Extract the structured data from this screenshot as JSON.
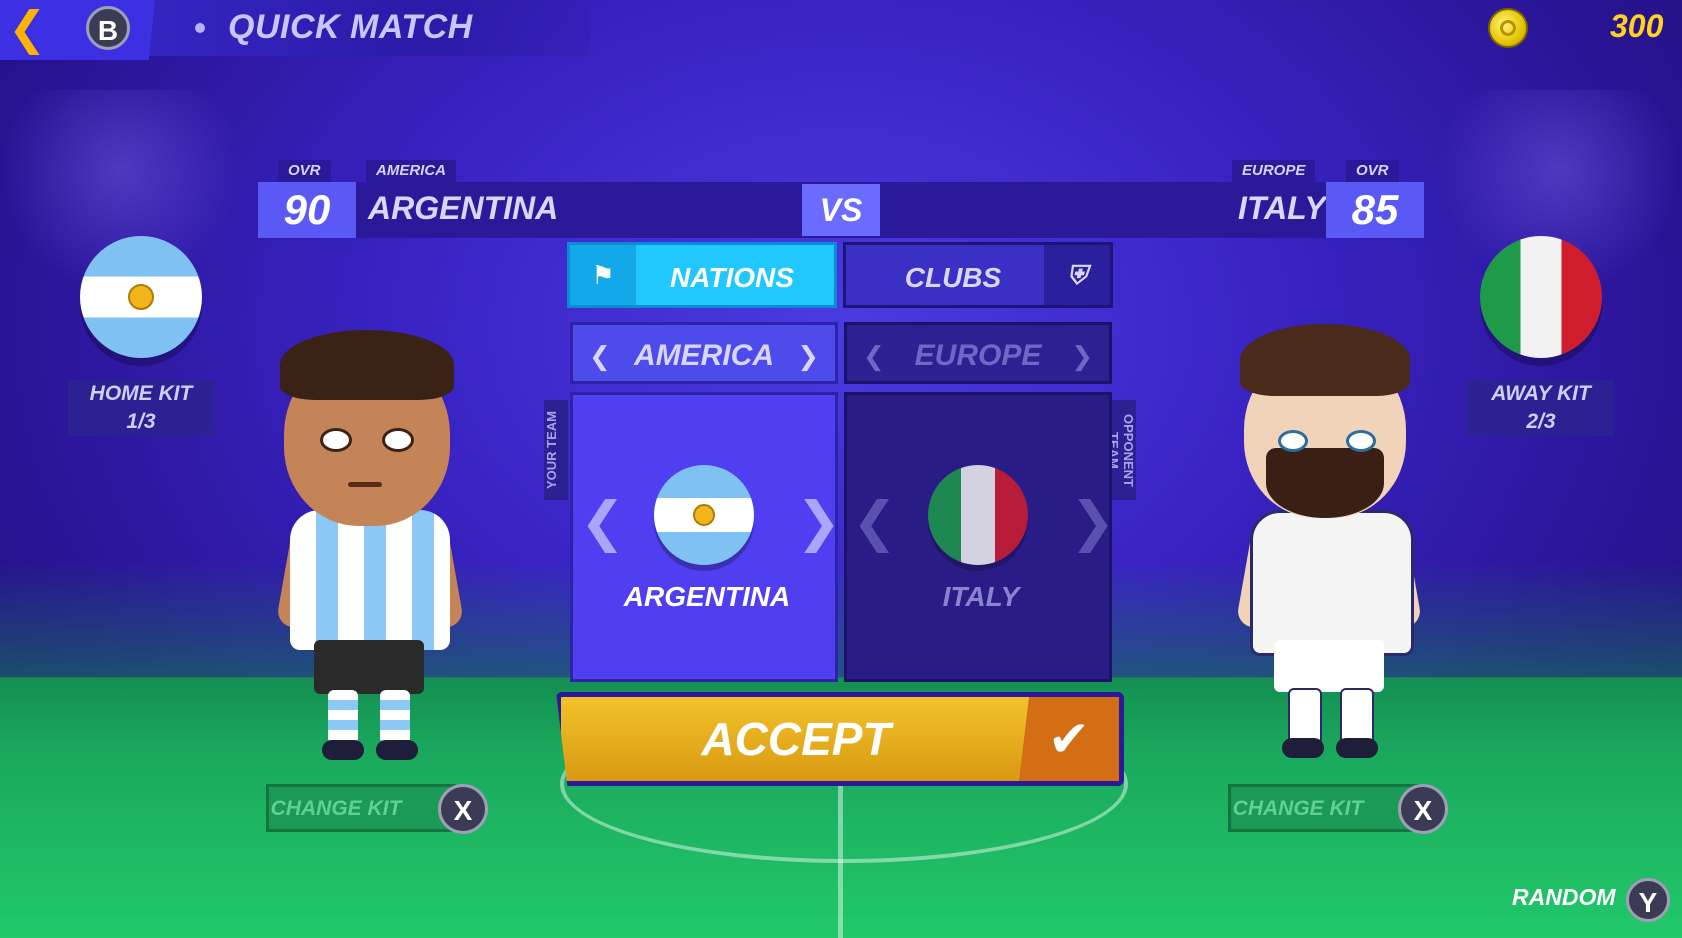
{
  "top_bar": {
    "back_button_key": "B",
    "title": "QUICK MATCH",
    "coins": "300",
    "icons": {
      "back": "chevron-left-icon",
      "coin": "coin-icon"
    }
  },
  "home_team": {
    "ovr_label": "OVR",
    "ovr": "90",
    "region_tag": "AMERICA",
    "name": "ARGENTINA",
    "kit_label": "HOME KIT",
    "kit_index": "1/3",
    "change_kit_label": "CHANGE KIT",
    "change_kit_key": "X"
  },
  "away_team": {
    "ovr_label": "OVR",
    "ovr": "85",
    "region_tag": "EUROPE",
    "name": "ITALY",
    "kit_label": "AWAY KIT",
    "kit_index": "2/3",
    "change_kit_label": "CHANGE KIT",
    "change_kit_key": "X"
  },
  "vs_label": "VS",
  "tabs": [
    {
      "label": "NATIONS",
      "active": true,
      "icon": "flag-icon"
    },
    {
      "label": "CLUBS",
      "active": false,
      "icon": "shield-icon"
    }
  ],
  "selector": {
    "your_team_label": "YOUR TEAM",
    "opponent_team_label": "OPPONENT TEAM",
    "left_region": "AMERICA",
    "right_region": "EUROPE",
    "left_team": "ARGENTINA",
    "right_team": "ITALY"
  },
  "accept_label": "ACCEPT",
  "random": {
    "label": "RANDOM",
    "key": "Y"
  },
  "colors": {
    "background": "#3a24c6",
    "accent_cyan": "#21c8ff",
    "accept_yellow": "#f3c22a",
    "coin_yellow": "#ffd21f",
    "ovr_blue": "#5a59f6"
  }
}
